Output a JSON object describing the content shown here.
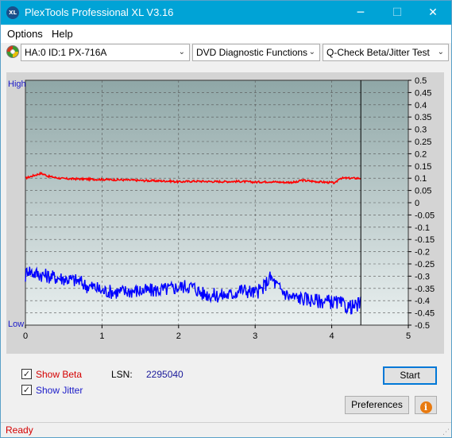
{
  "window": {
    "title": "PlexTools Professional XL V3.16",
    "app_icon_text": "XL",
    "minimize": "─",
    "maximize": "☐",
    "close": "✕"
  },
  "menu": {
    "options": "Options",
    "help": "Help"
  },
  "toolbar": {
    "device": "HA:0 ID:1  PX-716A",
    "function": "DVD Diagnostic Functions",
    "test": "Q-Check Beta/Jitter Test",
    "arrow": "⌄"
  },
  "chart_data": {
    "type": "line",
    "left_axis_labels": {
      "high": "High",
      "low": "Low"
    },
    "x_ticks": [
      "0",
      "1",
      "2",
      "3",
      "4",
      "5"
    ],
    "xlim": [
      0,
      5
    ],
    "y_right_ticks": [
      "0.5",
      "0.45",
      "0.4",
      "0.35",
      "0.3",
      "0.25",
      "0.2",
      "0.15",
      "0.1",
      "0.05",
      "0",
      "-0.05",
      "-0.1",
      "-0.15",
      "-0.2",
      "-0.25",
      "-0.3",
      "-0.35",
      "-0.4",
      "-0.45",
      "-0.5"
    ],
    "ylim": [
      -0.5,
      0.5
    ],
    "grid": true,
    "end_marker_x": 4.38,
    "series": [
      {
        "key": "beta",
        "color": "#ff0000",
        "x": [
          0,
          0.05,
          0.1,
          0.15,
          0.2,
          0.25,
          0.3,
          0.4,
          0.5,
          0.7,
          1.0,
          1.3,
          1.6,
          1.9,
          2.0,
          2.2,
          2.5,
          2.8,
          3.0,
          3.2,
          3.4,
          3.55,
          3.6,
          3.8,
          4.0,
          4.05,
          4.1,
          4.2,
          4.3,
          4.38
        ],
        "y": [
          0.1,
          0.105,
          0.11,
          0.115,
          0.12,
          0.115,
          0.108,
          0.102,
          0.098,
          0.097,
          0.095,
          0.093,
          0.09,
          0.088,
          0.085,
          0.088,
          0.086,
          0.087,
          0.084,
          0.086,
          0.083,
          0.084,
          0.092,
          0.086,
          0.082,
          0.08,
          0.1,
          0.1,
          0.1,
          0.1
        ]
      },
      {
        "key": "jitter",
        "color": "#0000ff",
        "x": [
          0,
          0.03,
          0.08,
          0.15,
          0.3,
          0.5,
          0.7,
          0.8,
          0.9,
          1.0,
          1.2,
          1.4,
          1.6,
          1.8,
          1.9,
          2.0,
          2.1,
          2.2,
          2.3,
          2.5,
          2.7,
          2.8,
          2.9,
          3.0,
          3.1,
          3.15,
          3.2,
          3.3,
          3.45,
          3.6,
          3.8,
          4.0,
          4.1,
          4.2,
          4.3,
          4.38
        ],
        "y": [
          -0.3,
          -0.27,
          -0.285,
          -0.29,
          -0.3,
          -0.31,
          -0.32,
          -0.34,
          -0.345,
          -0.36,
          -0.365,
          -0.36,
          -0.36,
          -0.355,
          -0.35,
          -0.345,
          -0.34,
          -0.345,
          -0.37,
          -0.38,
          -0.375,
          -0.355,
          -0.36,
          -0.37,
          -0.35,
          -0.325,
          -0.305,
          -0.345,
          -0.385,
          -0.39,
          -0.4,
          -0.405,
          -0.41,
          -0.425,
          -0.425,
          -0.41
        ]
      }
    ]
  },
  "controls": {
    "show_beta": "Show Beta",
    "show_jitter": "Show Jitter",
    "beta_checked": "✓",
    "jitter_checked": "✓",
    "lsn_label": "LSN:",
    "lsn_value": "2295040",
    "start": "Start",
    "preferences": "Preferences",
    "info": "i"
  },
  "status": {
    "text": "Ready",
    "grip": "⋰"
  }
}
